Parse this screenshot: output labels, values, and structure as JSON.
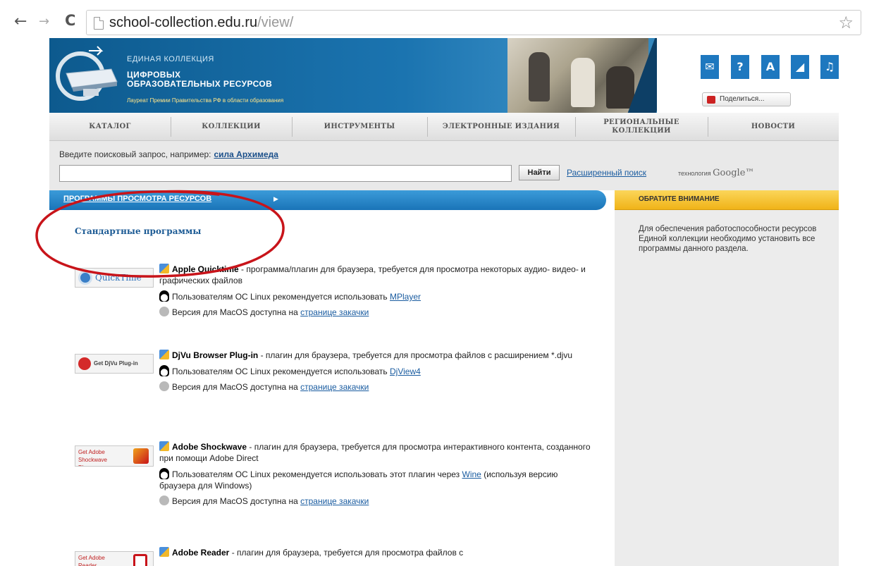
{
  "browser": {
    "url_host": "school-collection.edu.ru",
    "url_path": "/view/"
  },
  "header": {
    "logo_line1": "ЕДИНАЯ КОЛЛЕКЦИЯ",
    "logo_line2a": "ЦИФРОВЫХ",
    "logo_line2b": "ОБРАЗОВАТЕЛЬНЫХ РЕСУРСОВ",
    "logo_line3": "Лауреат Премии Правительства РФ в области образования",
    "icons": [
      "mail-icon",
      "help-icon",
      "font-size-icon",
      "stats-icon",
      "users-icon"
    ],
    "icon_glyphs": [
      "✉",
      "?",
      "A",
      "◢",
      "♫"
    ],
    "share_label": "Поделиться..."
  },
  "menu": {
    "items": [
      "КАТАЛОГ",
      "КОЛЛЕКЦИИ",
      "ИНСТРУМЕНТЫ",
      "ЭЛЕКТРОННЫЕ ИЗДАНИЯ",
      "РЕГИОНАЛЬНЫЕ КОЛЛЕКЦИИ",
      "НОВОСТИ"
    ]
  },
  "search": {
    "hint": "Введите поисковый запрос, например:",
    "example": "сила Архимеда",
    "value": "",
    "button": "Найти",
    "advanced": "Расширенный поиск",
    "tech_label": "технология",
    "tech_brand": "Google™"
  },
  "section": {
    "title": "ПРОГРАММЫ ПРОСМОТРА РЕСУРСОВ",
    "arrow": "▶",
    "subtitle": "Стандартные программы"
  },
  "plugins": [
    {
      "logo": "QuickTime",
      "title": "Apple Quicktime",
      "desc": " - программа/плагин для браузера, требуется для просмотра некоторых аудио- видео- и графических файлов",
      "linux_text": "Пользователям ОС Linux рекомендуется использовать ",
      "linux_link": "MPlayer",
      "linux_extra": "",
      "mac_text": "Версия для MacOS доступна на ",
      "mac_link": "странице закачки"
    },
    {
      "logo": "Get DjVu Plug-in",
      "title": "DjVu Browser Plug-in",
      "desc": " - плагин для браузера, требуется для просмотра файлов с расширением *.djvu",
      "linux_text": "Пользователям ОС Linux рекомендуется использовать ",
      "linux_link": "DjView4",
      "linux_extra": "",
      "mac_text": "Версия для MacOS доступна на ",
      "mac_link": "странице закачки"
    },
    {
      "logo": "Get Adobe Shockwave Player",
      "title": "Adobe Shockwave",
      "desc": " - плагин для браузера, требуется для просмотра интерактивного контента, созданного при помощи Adobe Direct",
      "linux_text": "Пользователям ОС Linux рекомендуется использовать этот плагин через ",
      "linux_link": "Wine",
      "linux_extra": " (используя версию браузера для Windows)",
      "mac_text": "Версия для MacOS доступна на ",
      "mac_link": "странице закачки"
    },
    {
      "logo": "Get Adobe Reader",
      "title": "Adobe Reader",
      "desc": " - плагин для браузера, требуется для просмотра файлов с",
      "linux_text": "",
      "linux_link": "",
      "linux_extra": "",
      "mac_text": "",
      "mac_link": ""
    }
  ],
  "sidebar": {
    "title": "ОБРАТИТЕ ВНИМАНИЕ",
    "text": "Для обеспечения работоспособности ресурсов Единой коллекции необходимо установить все программы данного раздела."
  },
  "colors": {
    "banner_blue": "#1b74b0",
    "section_blue": "#1a74b8",
    "notice_yellow": "#f0b318",
    "annotation_red": "#c8141a"
  }
}
